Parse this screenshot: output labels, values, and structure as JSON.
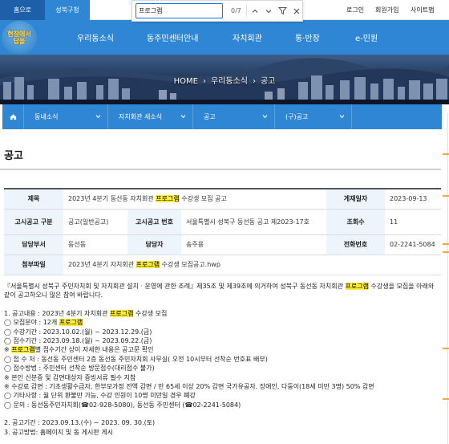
{
  "topbar": {
    "home_tab": "홈으로",
    "gu_tab": "성북구청",
    "login": "로그인",
    "join": "회원가입",
    "sitemap": "사이트맵"
  },
  "findbar": {
    "query": "프로그램",
    "count": "0/7"
  },
  "logo": {
    "line1": "현장에서",
    "line2": "답을"
  },
  "nav": {
    "items": [
      "우리동소식",
      "동주민센터안내",
      "자치회관",
      "통·반장",
      "e-민원"
    ]
  },
  "hero": {
    "breadcrumb": [
      "HOME",
      "우리동소식",
      "공고"
    ]
  },
  "subnav": {
    "items": [
      "동네소식",
      "자치회관 새소식",
      "공고",
      "(구)공고"
    ]
  },
  "page": {
    "title": "공고"
  },
  "info": {
    "subject_label": "제목",
    "subject_pre": "2023년 4분기 동선동 자치회관",
    "subject_hl": "프로그램",
    "subject_post": "수강생 모집 공고",
    "date_label": "게재일자",
    "date_value": "2023-09-13",
    "type_label": "고시공고 구분",
    "type_value": "공고(일반공고)",
    "number_label": "고시공고 번호",
    "number_value": "서울특별시 성북구 동선동 공고 제2023-17호",
    "views_label": "조회수",
    "views_value": "11",
    "dept_label": "담당부서",
    "dept_value": "동선동",
    "person_label": "담당자",
    "person_value": "송주용",
    "phone_label": "전화번호",
    "phone_value": "02-2241-5084",
    "file_label": "첨부파일",
    "file_pre": "2023년 4분기 자치회관",
    "file_hl": "프로그램",
    "file_post": "수강생 모집공고.hwp"
  },
  "content": {
    "intro_pre": "『서울특별시 성북구 주민자치회 및 자치회관 설치 · 운영에 관한 조례』제35조 및 제39조에 의거하여 성북구 동선동 자치회관",
    "intro_hl": "프로그램",
    "intro_post": "수강생을 모집을 아래와 같이 공고하오니 많은 참여 바랍니다.",
    "l1_pre": "1. 공고내용 : 2023년 4분기 자치회관",
    "l1_hl": "프로그램",
    "l1_post": "수강생 모집",
    "l2_pre": "◯ 모집분야 : 12개",
    "l2_hl": "프로그램",
    "l3": "◯ 수강기간 : 2023.10.02.(월) ~ 2023.12.29.(금)",
    "l4": "◯ 접수기간 : 2023.09.18.(월) ~ 2023.09.22.(금)",
    "l5_pre": "※",
    "l5_hl": "프로그램",
    "l5_post": "별 접수기간 상이 자세한 내용은 공고문 확인",
    "l6": "◯ 접 수 처 : 동선동 주민센터 2층 동선동 주민자치회 사무실( 오전 10시부터 선착순 번호표 배부)",
    "l7": "◯ 접수방법 : 주민센터 선착순 방문접수(대리접수 불가)",
    "l8": "※ 본인 신분증 및 감면대상자 증빙서류 필수 지참",
    "l9": "※ 수강료 감면 : 기초생활수급자, 한부모가정 전액 감면 / 만 65세 이상 20% 감면 국가유공자, 장애인, 다둥이(18세 미만 3명) 50% 감면",
    "l10": "◯ 기타사항 : 월 단위 환불만 가능, 수강 인원이 10명 미만일 경우 폐강",
    "l11": "◯ 문의 : 동선동주민자치회(☎02-928-5080), 동선동 주민센터 (☎02-2241-5084)",
    "l12": "2. 공고기간 : 2023.09.13.(수) ~ 2023. 09. 30.(토)",
    "l13": "3. 공고방법: 홈페이지 및 동 게시판 게시"
  },
  "colors": {
    "brand_blue": "#2f86d4",
    "home_blue": "#1d5fa8",
    "highlight": "#ffee33",
    "header_cell": "#eef4fb",
    "scroll_mark": "#f5a64a"
  }
}
